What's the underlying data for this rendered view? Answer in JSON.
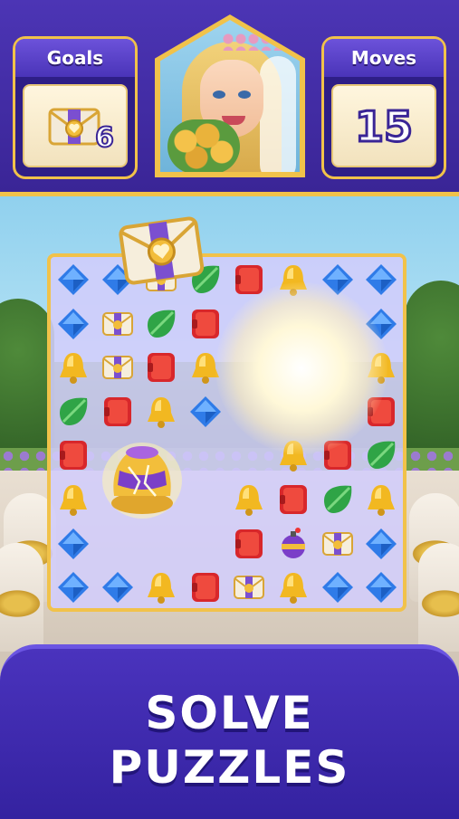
{
  "header": {
    "goals_label": "Goals",
    "goal_count": "6",
    "goal_icon": "envelope-heart-icon",
    "moves_label": "Moves",
    "moves_value": "15",
    "portrait": "bride-avatar"
  },
  "board": {
    "rows": 8,
    "cols": 8,
    "grid": [
      [
        "diamond",
        "diamond",
        "envelope",
        "leaf",
        "book",
        "bell",
        "diamond",
        "diamond"
      ],
      [
        "diamond",
        "envelope",
        "leaf",
        "book",
        "blast",
        "blast",
        "blast",
        "diamond"
      ],
      [
        "bell",
        "envelope",
        "book",
        "bell",
        "blast",
        "blast",
        "blast",
        "bell"
      ],
      [
        "leaf",
        "book",
        "bell",
        "diamond",
        "blast",
        "blast",
        "blast",
        "book"
      ],
      [
        "book",
        "blast",
        "blast",
        "blast",
        "blast",
        "bell",
        "book",
        "leaf"
      ],
      [
        "bell",
        "blast",
        "jar",
        "blast",
        "bell",
        "book",
        "leaf",
        "bell"
      ],
      [
        "diamond",
        "blast",
        "blast",
        "blast",
        "book",
        "bomb",
        "envelope",
        "diamond"
      ],
      [
        "diamond",
        "diamond",
        "bell",
        "book",
        "envelope",
        "bell",
        "diamond",
        "diamond"
      ]
    ]
  },
  "footer": {
    "line1": "SOLVE",
    "line2": "PUZZLES"
  },
  "colors": {
    "header_bg": "#4c35b5",
    "gold": "#f1c24a",
    "board_bg": "#d2cdfa",
    "footer_bg": "#4a33bd"
  }
}
